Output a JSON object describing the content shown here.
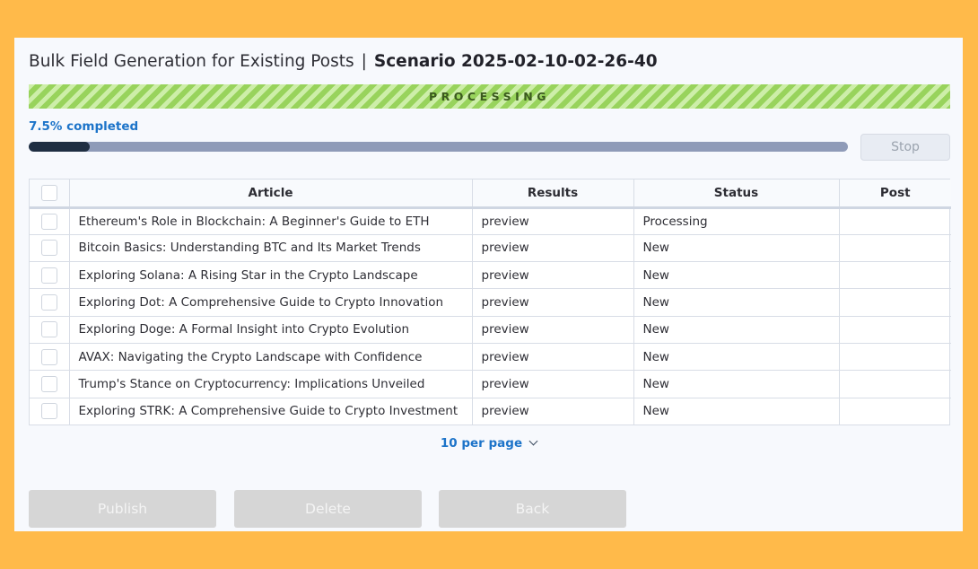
{
  "header": {
    "title": "Bulk Field Generation for Existing Posts",
    "separator": "|",
    "scenario": "Scenario 2025-02-10-02-26-40"
  },
  "banner": {
    "label": "PROCESSING",
    "color": "#A9DC6E"
  },
  "progress": {
    "text": "7.5% completed",
    "value_percent": 7.5
  },
  "stop_label": "Stop",
  "table": {
    "columns": [
      "Article",
      "Results",
      "Status",
      "Post"
    ],
    "rows": [
      {
        "article": "Ethereum's Role in Blockchain: A Beginner's Guide to ETH",
        "results": "preview",
        "status": "Processing",
        "post": ""
      },
      {
        "article": "Bitcoin Basics: Understanding BTC and Its Market Trends",
        "results": "preview",
        "status": "New",
        "post": ""
      },
      {
        "article": "Exploring Solana: A Rising Star in the Crypto Landscape",
        "results": "preview",
        "status": "New",
        "post": ""
      },
      {
        "article": "Exploring Dot: A Comprehensive Guide to Crypto Innovation",
        "results": "preview",
        "status": "New",
        "post": ""
      },
      {
        "article": "Exploring Doge: A Formal Insight into Crypto Evolution",
        "results": "preview",
        "status": "New",
        "post": ""
      },
      {
        "article": "AVAX: Navigating the Crypto Landscape with Confidence",
        "results": "preview",
        "status": "New",
        "post": ""
      },
      {
        "article": "Trump's Stance on Cryptocurrency: Implications Unveiled",
        "results": "preview",
        "status": "New",
        "post": ""
      },
      {
        "article": "Exploring STRK: A Comprehensive Guide to Crypto Investment",
        "results": "preview",
        "status": "New",
        "post": ""
      }
    ]
  },
  "pagination": {
    "per_page_label": "10 per page"
  },
  "actions": {
    "publish": "Publish",
    "delete": "Delete",
    "back": "Back"
  },
  "colors": {
    "background": "#FFBA4A",
    "accent": "#1D74C9",
    "progress_fill": "#1F2E42"
  }
}
